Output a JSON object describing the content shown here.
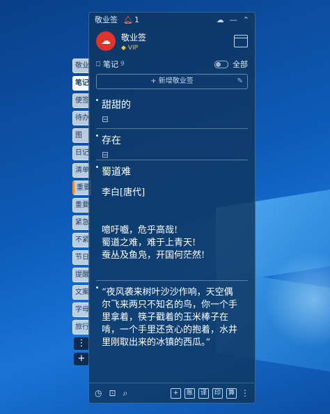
{
  "titlebar": {
    "app_title": "敬业签",
    "notice_count": "1"
  },
  "profile": {
    "name": "敬业签",
    "badge": "VIP"
  },
  "notes_header": {
    "label": "笔记",
    "count": "9",
    "filter": "全部"
  },
  "add_button": {
    "label": "+ 新增敬业签"
  },
  "side_tabs": [
    "敬业",
    "笔记",
    "便签",
    "待办",
    "图",
    "日记",
    "清单",
    "重要",
    "重要",
    "紧急",
    "不紧",
    "节日",
    "提醒",
    "文案",
    "字母",
    "旅行"
  ],
  "side_buttons": {
    "more": "⋮",
    "add": "+"
  },
  "notes": [
    {
      "title": "甜甜的"
    },
    {
      "title": "存在"
    },
    {
      "title": "蜀道难",
      "lines": [
        "李白[唐代]",
        "",
        "",
        "噫吁嚱，危乎高哉!",
        "蜀道之难，难于上青天!",
        "蚕丛及鱼凫，开国何茫然!"
      ]
    },
    {
      "body": "“夜风袭来树叶沙沙作响，天空偶尔飞来两只不知名的鸟，你一个手里拿着，筷子戳着的玉米棒子在啃，一个手里还贪心的抱着，水井里刚取出来的冰镇的西瓜。”"
    }
  ],
  "footer": {
    "buttons": [
      "+",
      "账",
      "译",
      "印",
      "算"
    ]
  }
}
